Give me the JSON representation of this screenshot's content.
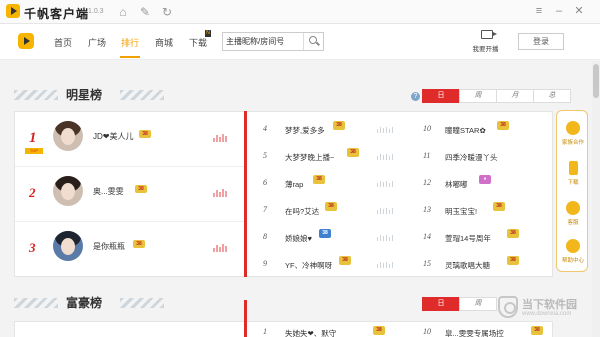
{
  "app": {
    "title": "千帆客户端",
    "version": "1.0.3"
  },
  "nav": {
    "items": [
      {
        "label": "首页"
      },
      {
        "label": "广场"
      },
      {
        "label": "排行"
      },
      {
        "label": "商城"
      },
      {
        "label": "下载"
      }
    ],
    "active": "排行",
    "search_value": "主播昵称/房间号",
    "broadcast_label": "我要开播",
    "login_label": "登录"
  },
  "star_section": {
    "title": "明星榜",
    "tabs": [
      "日",
      "周",
      "月",
      "总"
    ],
    "active_tab": "日",
    "top3": [
      {
        "rank": "1",
        "name": "JD❤美人儿",
        "badge": "38"
      },
      {
        "rank": "2",
        "name": "奥...雯雯",
        "badge": "38"
      },
      {
        "rank": "3",
        "name": "是你瓶瓶",
        "badge": "38"
      }
    ],
    "left_list": [
      {
        "rank": "4",
        "name": "梦梦,爱多多",
        "badge": "38"
      },
      {
        "rank": "5",
        "name": "大梦梦晚上播~",
        "badge": "38"
      },
      {
        "rank": "6",
        "name": "薄rap",
        "badge": "38"
      },
      {
        "rank": "7",
        "name": "在吗?艾达",
        "badge": "38"
      },
      {
        "rank": "8",
        "name": "娇娘娘♥",
        "badge": "38"
      },
      {
        "rank": "9",
        "name": "YF、冷神啊呀",
        "badge": "38"
      }
    ],
    "right_list": [
      {
        "rank": "10",
        "name": "瞳瞳STAR✿",
        "badge": "38"
      },
      {
        "rank": "11",
        "name": "四季冷暖漫丫头",
        "badge": "38"
      },
      {
        "rank": "12",
        "name": "林嘟嘟",
        "badge": "♦"
      },
      {
        "rank": "13",
        "name": "明玉宝宝!",
        "badge": "38"
      },
      {
        "rank": "14",
        "name": "萱瑁14号周年",
        "badge": "38"
      },
      {
        "rank": "15",
        "name": "灵璃歌唱大糖",
        "badge": "38"
      }
    ]
  },
  "rich_section": {
    "title": "富豪榜",
    "tabs": [
      "日",
      "周"
    ],
    "active_tab": "日",
    "row1": {
      "rank": "1",
      "name": "失她失❤、默守",
      "badge": "38"
    },
    "row10": {
      "rank": "10",
      "name": "皐...雯雯专属场控",
      "badge": "38"
    }
  },
  "side_toolbar": [
    {
      "label": "家族合作",
      "icon": "people-icon"
    },
    {
      "label": "下载",
      "icon": "phone-icon"
    },
    {
      "label": "客服",
      "icon": "chat-icon"
    },
    {
      "label": "帮助中心",
      "icon": "help-icon"
    }
  ],
  "watermark": {
    "title": "当下软件园",
    "url": "www.downxia.com"
  }
}
